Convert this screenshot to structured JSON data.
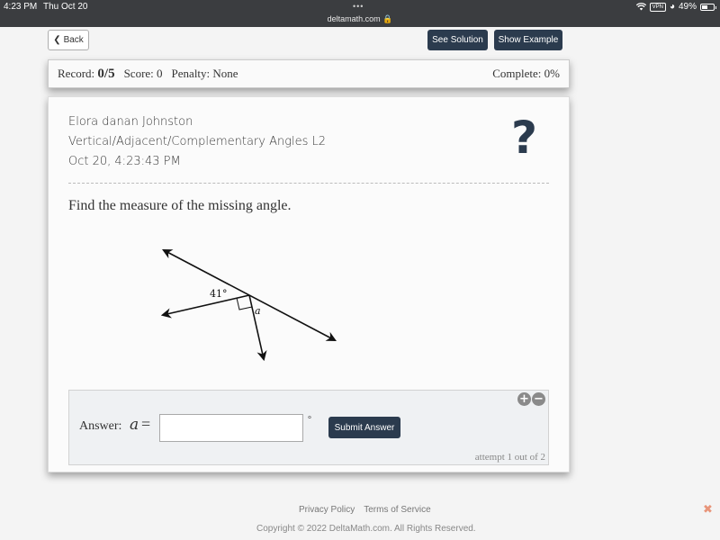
{
  "status_bar": {
    "time": "4:23 PM",
    "date": "Thu Oct 20",
    "dots": "•••",
    "url": "deltamath.com",
    "vpn": "VPN",
    "battery_percent": "49%",
    "battery_level": 0.49
  },
  "toolbar": {
    "back_label": "Back",
    "see_solution_label": "See Solution",
    "show_example_label": "Show Example"
  },
  "record_bar": {
    "record_label": "Record:",
    "record_value": "0/5",
    "score_label": "Score: 0",
    "penalty_label": "Penalty: None",
    "complete_label": "Complete: 0%"
  },
  "problem": {
    "student_name": "Elora danan Johnston",
    "topic": "Vertical/Adjacent/Complementary Angles L2",
    "timestamp": "Oct 20, 4:23:43 PM",
    "help_icon": "?",
    "prompt": "Find the measure of the missing angle.",
    "figure": {
      "given_angle_label": "41°",
      "unknown_angle_label": "a",
      "right_angle_marker": true
    }
  },
  "answer": {
    "label": "Answer:",
    "variable": "a",
    "equals": "=",
    "input_value": "",
    "unit": "°",
    "submit_label": "Submit Answer",
    "plus_icon": "+",
    "minus_icon": "−",
    "attempt_text": "attempt 1 out of 2"
  },
  "footer": {
    "privacy_label": "Privacy Policy",
    "terms_label": "Terms of Service",
    "copyright": "Copyright © 2022 DeltaMath.com. All Rights Reserved.",
    "close_icon": "✖"
  }
}
